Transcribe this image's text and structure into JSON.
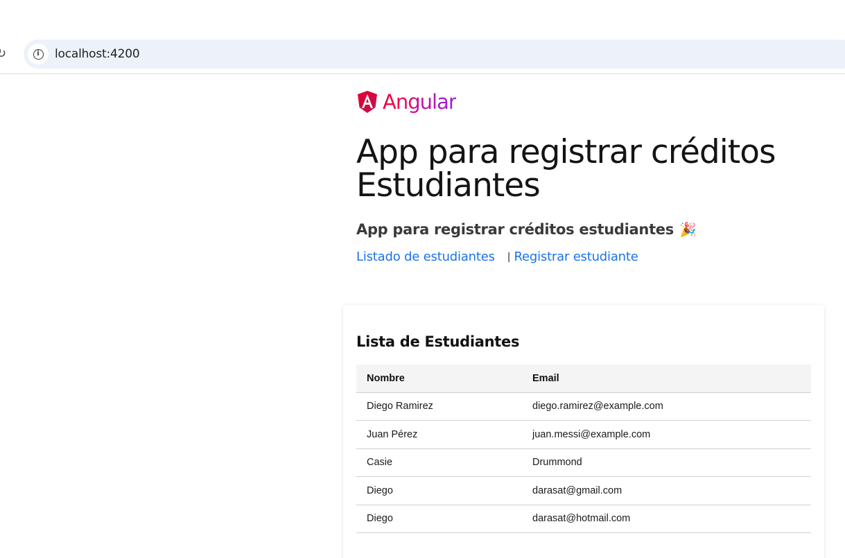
{
  "browser": {
    "url": "localhost:4200"
  },
  "header": {
    "logo_text": "Angular",
    "title_line1": "App para registrar créditos",
    "title_line2": "Estudiantes",
    "subtitle": "App para registrar créditos estudiantes",
    "subtitle_emoji": "🎉"
  },
  "nav": {
    "list_link": "Listado de estudiantes",
    "separator": "|",
    "register_link": "Registrar estudiante"
  },
  "students": {
    "title": "Lista de Estudiantes",
    "columns": [
      "Nombre",
      "Email"
    ],
    "rows": [
      {
        "name": "Diego Ramirez",
        "email": "diego.ramirez@example.com"
      },
      {
        "name": "Juan Pérez",
        "email": "juan.messi@example.com"
      },
      {
        "name": "Casie",
        "email": "Drummond"
      },
      {
        "name": "Diego",
        "email": "darasat@gmail.com"
      },
      {
        "name": "Diego",
        "email": "darasat@hotmail.com"
      }
    ]
  },
  "colors": {
    "link": "#1a73e8",
    "omnibox": "#edf2fa",
    "table_header_bg": "#f4f4f4"
  }
}
